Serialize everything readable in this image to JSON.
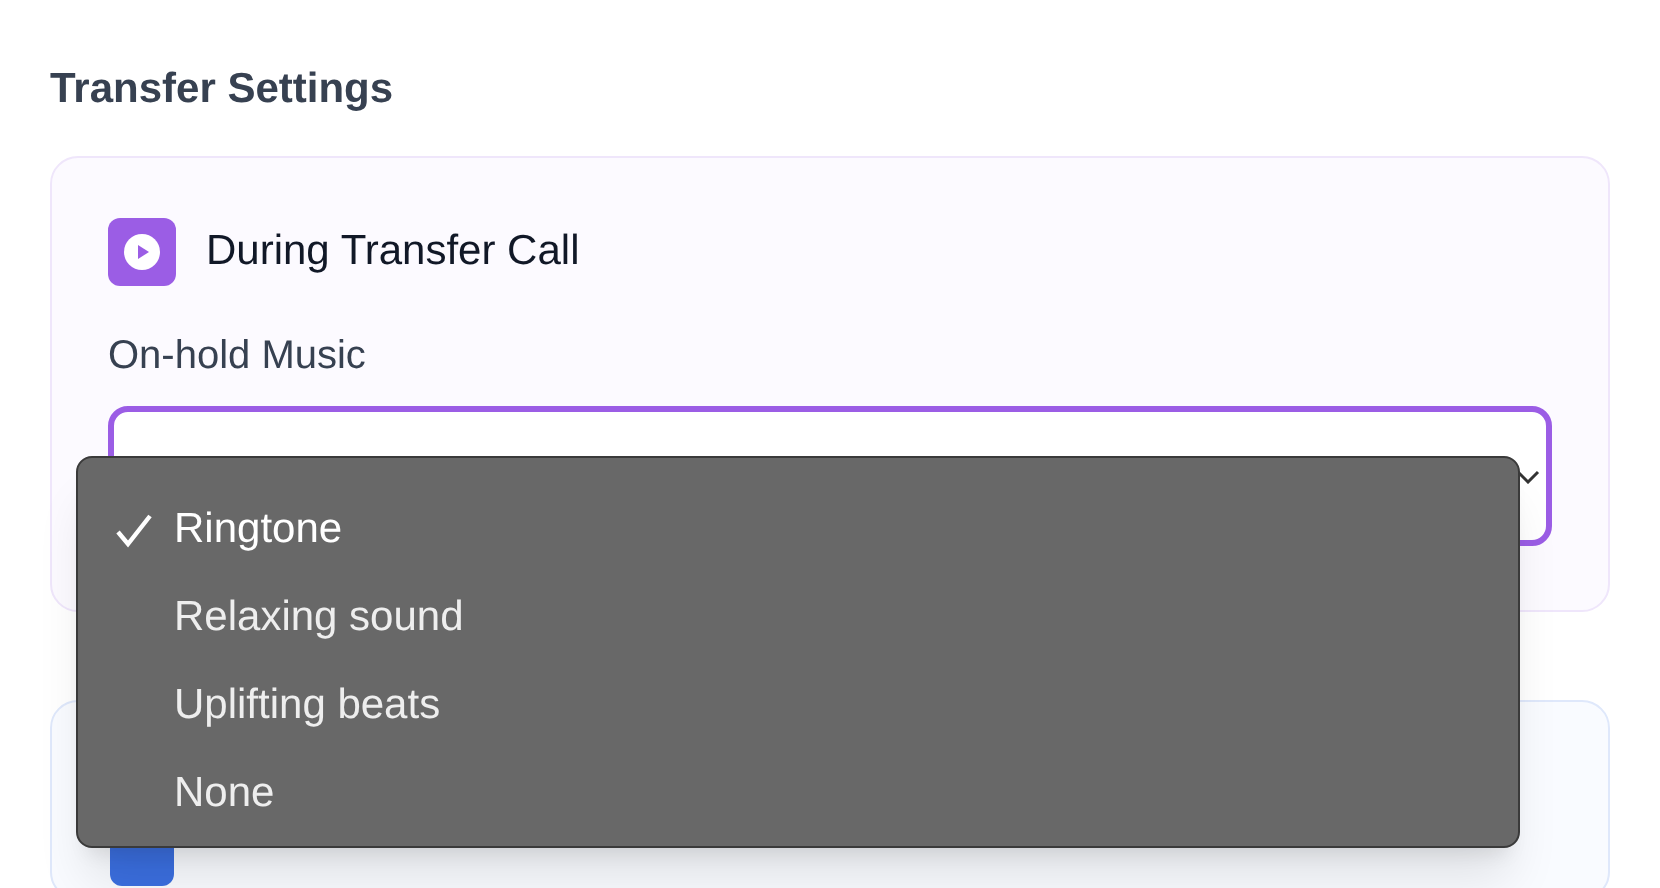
{
  "section_title": "Transfer Settings",
  "card": {
    "title": "During Transfer Call",
    "field_label": "On-hold Music"
  },
  "menu": {
    "items": [
      {
        "label": "Ringtone",
        "selected": true
      },
      {
        "label": "Relaxing sound",
        "selected": false
      },
      {
        "label": "Uplifting beats",
        "selected": false
      },
      {
        "label": "None",
        "selected": false
      }
    ]
  }
}
